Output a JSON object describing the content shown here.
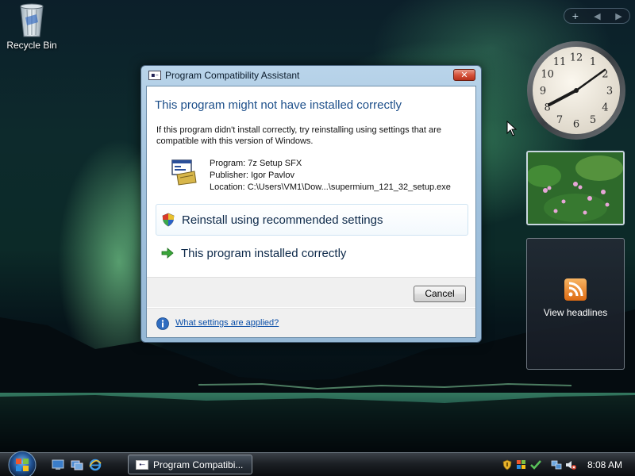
{
  "desktop": {
    "recycle_bin_label": "Recycle Bin"
  },
  "sidebar": {
    "controls": [
      "+",
      "◀",
      "▶"
    ],
    "feed_label": "View headlines"
  },
  "dialog": {
    "title": "Program Compatibility Assistant",
    "heading": "This program might not have installed correctly",
    "description": "If this program didn't install correctly, try reinstalling using settings that are compatible with this version of Windows.",
    "program": {
      "name_line": "Program: 7z Setup SFX",
      "publisher_line": "Publisher: Igor Pavlov",
      "location_line": "Location: C:\\Users\\VM1\\Dow...\\supermium_121_32_setup.exe"
    },
    "option_reinstall": "Reinstall using recommended settings",
    "option_installed": "This program installed correctly",
    "cancel_label": "Cancel",
    "help_link": "What settings are applied?",
    "close_glyph": "✕"
  },
  "taskbar": {
    "task_label": "Program Compatibi...",
    "clock": "8:08 AM"
  },
  "colors": {
    "heading": "#1d4f8a",
    "link": "#0b4fa8",
    "close_button": "#d6533b"
  },
  "icons": {
    "reinstall": "shield-icon",
    "installed": "green-arrow-icon",
    "help": "info-icon"
  }
}
